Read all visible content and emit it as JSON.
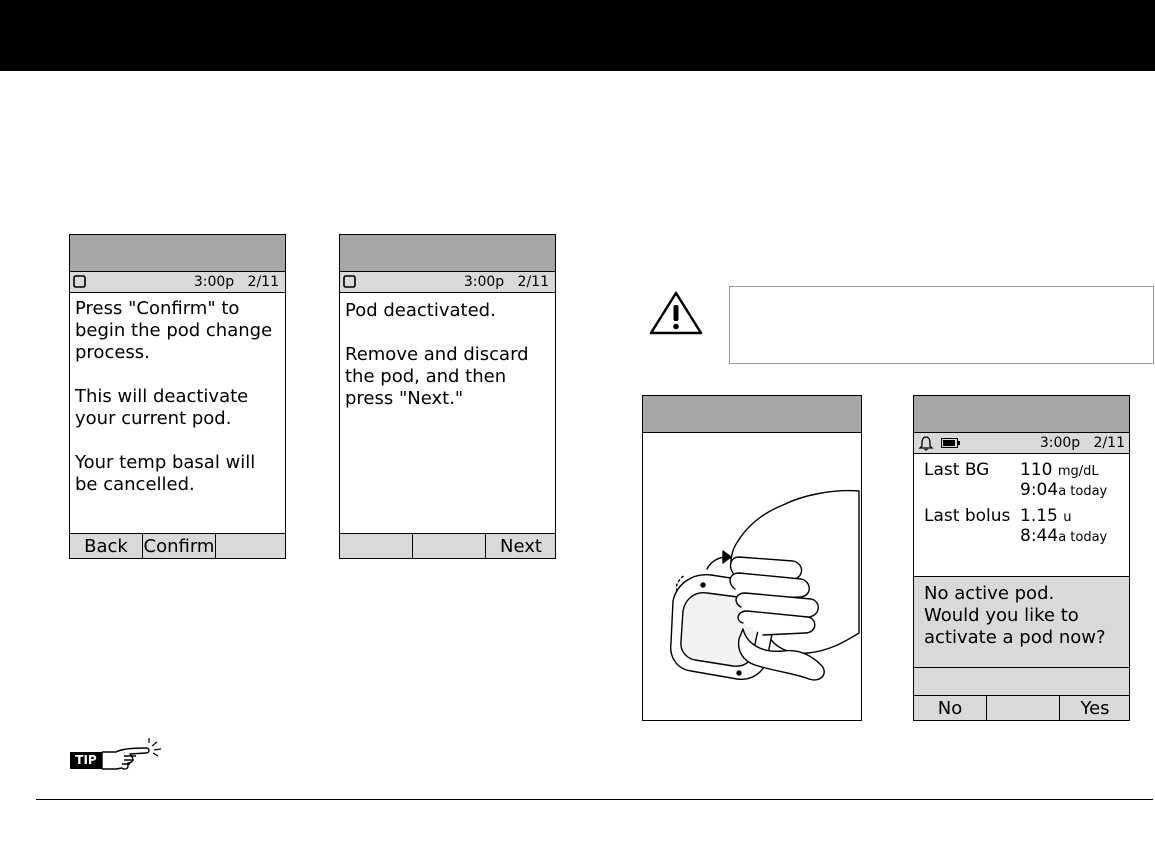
{
  "screen_left": {
    "status_time": "3:00p",
    "status_date": "2/11",
    "paragraphs": [
      "Press \"Confirm\" to begin the pod change process.",
      "This will deactivate your current pod.",
      "Your temp basal will be cancelled."
    ],
    "softkeys": [
      "Back",
      "Confirm",
      ""
    ]
  },
  "screen_mid": {
    "status_time": "3:00p",
    "status_date": "2/11",
    "paragraphs": [
      "Pod deactivated.",
      "Remove and discard the pod, and then press \"Next.\""
    ],
    "softkeys": [
      "",
      "",
      "Next"
    ]
  },
  "screen_right": {
    "status_time": "3:00p",
    "status_date": "2/11",
    "last_bg_label": "Last BG",
    "last_bg_value": "110",
    "last_bg_unit": "mg/dL",
    "last_bg_time": "9:04",
    "last_bg_time_suffix": "a today",
    "last_bolus_label": "Last bolus",
    "last_bolus_value": "1.15",
    "last_bolus_unit": "u",
    "last_bolus_time": "8:44",
    "last_bolus_time_suffix": "a today",
    "alert_lines": [
      "No active pod.",
      "Would you like to",
      "activate a pod now?"
    ],
    "softkeys": [
      "No",
      "",
      "Yes"
    ]
  },
  "tip_label": "TIP"
}
